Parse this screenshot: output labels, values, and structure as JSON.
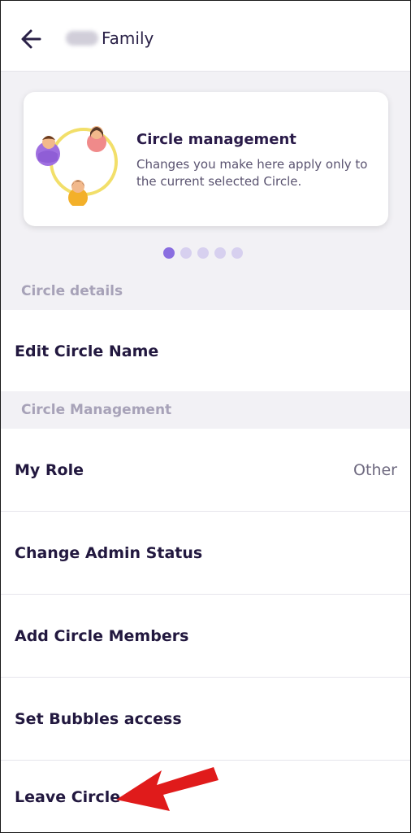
{
  "header": {
    "back_icon": "arrow-left-icon",
    "title": "Family",
    "title_prefix_redacted": true
  },
  "promo_card": {
    "title": "Circle management",
    "body": "Changes you make here apply only to the current selected Circle.",
    "illustration": "three-people-circle-illustration"
  },
  "carousel": {
    "count": 5,
    "active_index": 0
  },
  "sections": {
    "circle_details": "Circle details",
    "circle_management": "Circle Management"
  },
  "rows": {
    "edit_name": "Edit Circle Name",
    "my_role": "My Role",
    "my_role_value": "Other",
    "change_admin": "Change Admin Status",
    "add_members": "Add Circle Members",
    "set_bubbles": "Set Bubbles access",
    "leave_circle": "Leave Circle"
  },
  "annotation": {
    "icon": "red-arrow-annotation",
    "color": "#e01b1b"
  },
  "colors": {
    "accent": "#8a6ee0",
    "dark_text": "#22183f",
    "section_text": "#a7a2b8",
    "background": "#f2f1f5"
  }
}
